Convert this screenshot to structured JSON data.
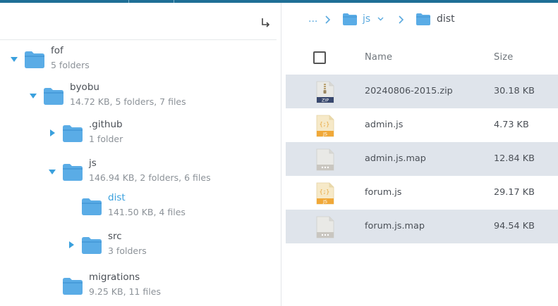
{
  "tree": {
    "nodes": [
      {
        "name": "fof",
        "meta": "5 folders",
        "state": "expanded"
      },
      {
        "name": "byobu",
        "meta": "14.72 KB, 5 folders, 7 files",
        "state": "expanded"
      },
      {
        "name": ".github",
        "meta": "1 folder",
        "state": "collapsed"
      },
      {
        "name": "js",
        "meta": "146.94 KB, 2 folders, 6 files",
        "state": "expanded"
      },
      {
        "name": "dist",
        "meta": "141.50 KB, 4 files",
        "state": "active"
      },
      {
        "name": "src",
        "meta": "3 folders",
        "state": "collapsed"
      },
      {
        "name": "migrations",
        "meta": "9.25 KB, 11 files",
        "state": "none"
      }
    ]
  },
  "breadcrumb": {
    "ellipsis": "...",
    "parent": "js",
    "current": "dist"
  },
  "table": {
    "headers": {
      "name": "Name",
      "size": "Size"
    },
    "rows": [
      {
        "name": "20240806-2015.zip",
        "size": "30.18 KB",
        "icon": "zip-file-icon",
        "icon_label": "ZIP"
      },
      {
        "name": "admin.js",
        "size": "4.73 KB",
        "icon": "js-file-icon",
        "icon_label": "JS"
      },
      {
        "name": "admin.js.map",
        "size": "12.84 KB",
        "icon": "generic-file-icon",
        "icon_label": ""
      },
      {
        "name": "forum.js",
        "size": "29.17 KB",
        "icon": "js-file-icon",
        "icon_label": "JS"
      },
      {
        "name": "forum.js.map",
        "size": "94.54 KB",
        "icon": "generic-file-icon",
        "icon_label": ""
      }
    ]
  },
  "colors": {
    "folder": "#5aace6",
    "folder_dark": "#3f93d3",
    "accent": "#3aa0dd",
    "row_highlight": "#dfe4eb",
    "topbar": "#1f6f96"
  }
}
